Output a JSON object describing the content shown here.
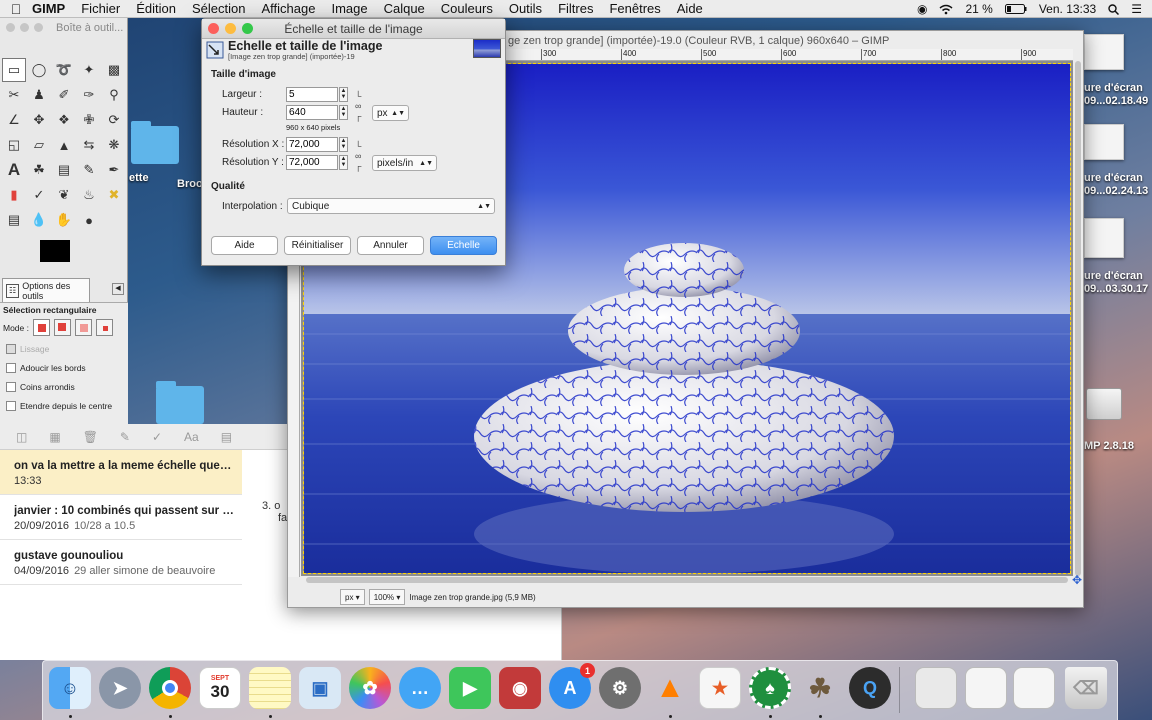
{
  "menubar": {
    "app": "GIMP",
    "items": [
      "Fichier",
      "Édition",
      "Sélection",
      "Affichage",
      "Image",
      "Calque",
      "Couleurs",
      "Outils",
      "Filtres",
      "Fenêtres",
      "Aide"
    ],
    "battery": "21 %",
    "clock": "Ven. 13:33"
  },
  "desktop": {
    "labels": [
      "ette",
      "Brook",
      "ure d'écran",
      "09...02.18.49",
      "ure d'écran",
      "09...02.24.13",
      "ure d'écran",
      "09...03.30.17",
      "MP 2.8.18"
    ]
  },
  "toolbox": {
    "title": "Boîte à outil...",
    "options_tab": "Options des outils",
    "section": "Sélection rectangulaire",
    "mode_label": "Mode :",
    "options": [
      "Lissage",
      "Adoucir les bords",
      "Coins arrondis",
      "Etendre depuis le centre"
    ]
  },
  "notes": {
    "items": [
      {
        "title": "on va la mettre a la meme échelle que s...",
        "date": "13:33",
        "preview": ""
      },
      {
        "title": "janvier : 10 combinés qui passent sur 2...",
        "date": "20/09/2016",
        "preview": "10/28 a 10.5"
      },
      {
        "title": "gustave gounouliou",
        "date": "04/09/2016",
        "preview": "29 aller simone de beauvoire"
      }
    ],
    "body_line1": "3.  o",
    "body_line2": "fa"
  },
  "image_window": {
    "title": "ge zen trop grande] (importée)-19.0 (Couleur RVB, 1 calque) 960x640 – GIMP",
    "ruler_marks": [
      "300",
      "400",
      "500",
      "600",
      "700",
      "800",
      "900"
    ],
    "unit": "px",
    "zoom": "100%",
    "status": "Image zen trop grande.jpg (5,9 MB)"
  },
  "dialog": {
    "window_title": "Échelle et taille de l'image",
    "header_title": "Echelle et taille de l'image",
    "header_sub": "[Image zen trop grande] (importée)-19",
    "section_size": "Taille d'image",
    "width_label": "Largeur :",
    "width_value": "5",
    "height_label": "Hauteur :",
    "height_value": "640",
    "pixels_note": "960 x 640 pixels",
    "size_unit": "px",
    "resx_label": "Résolution X :",
    "resx_value": "72,000",
    "resy_label": "Résolution Y :",
    "resy_value": "72,000",
    "res_unit": "pixels/in",
    "section_quality": "Qualité",
    "interp_label": "Interpolation :",
    "interp_value": "Cubique",
    "buttons": {
      "help": "Aide",
      "reset": "Réinitialiser",
      "cancel": "Annuler",
      "scale": "Echelle"
    }
  },
  "dock": {
    "calendar_month": "SEPT",
    "calendar_day": "30",
    "appstore_badge": "1"
  }
}
